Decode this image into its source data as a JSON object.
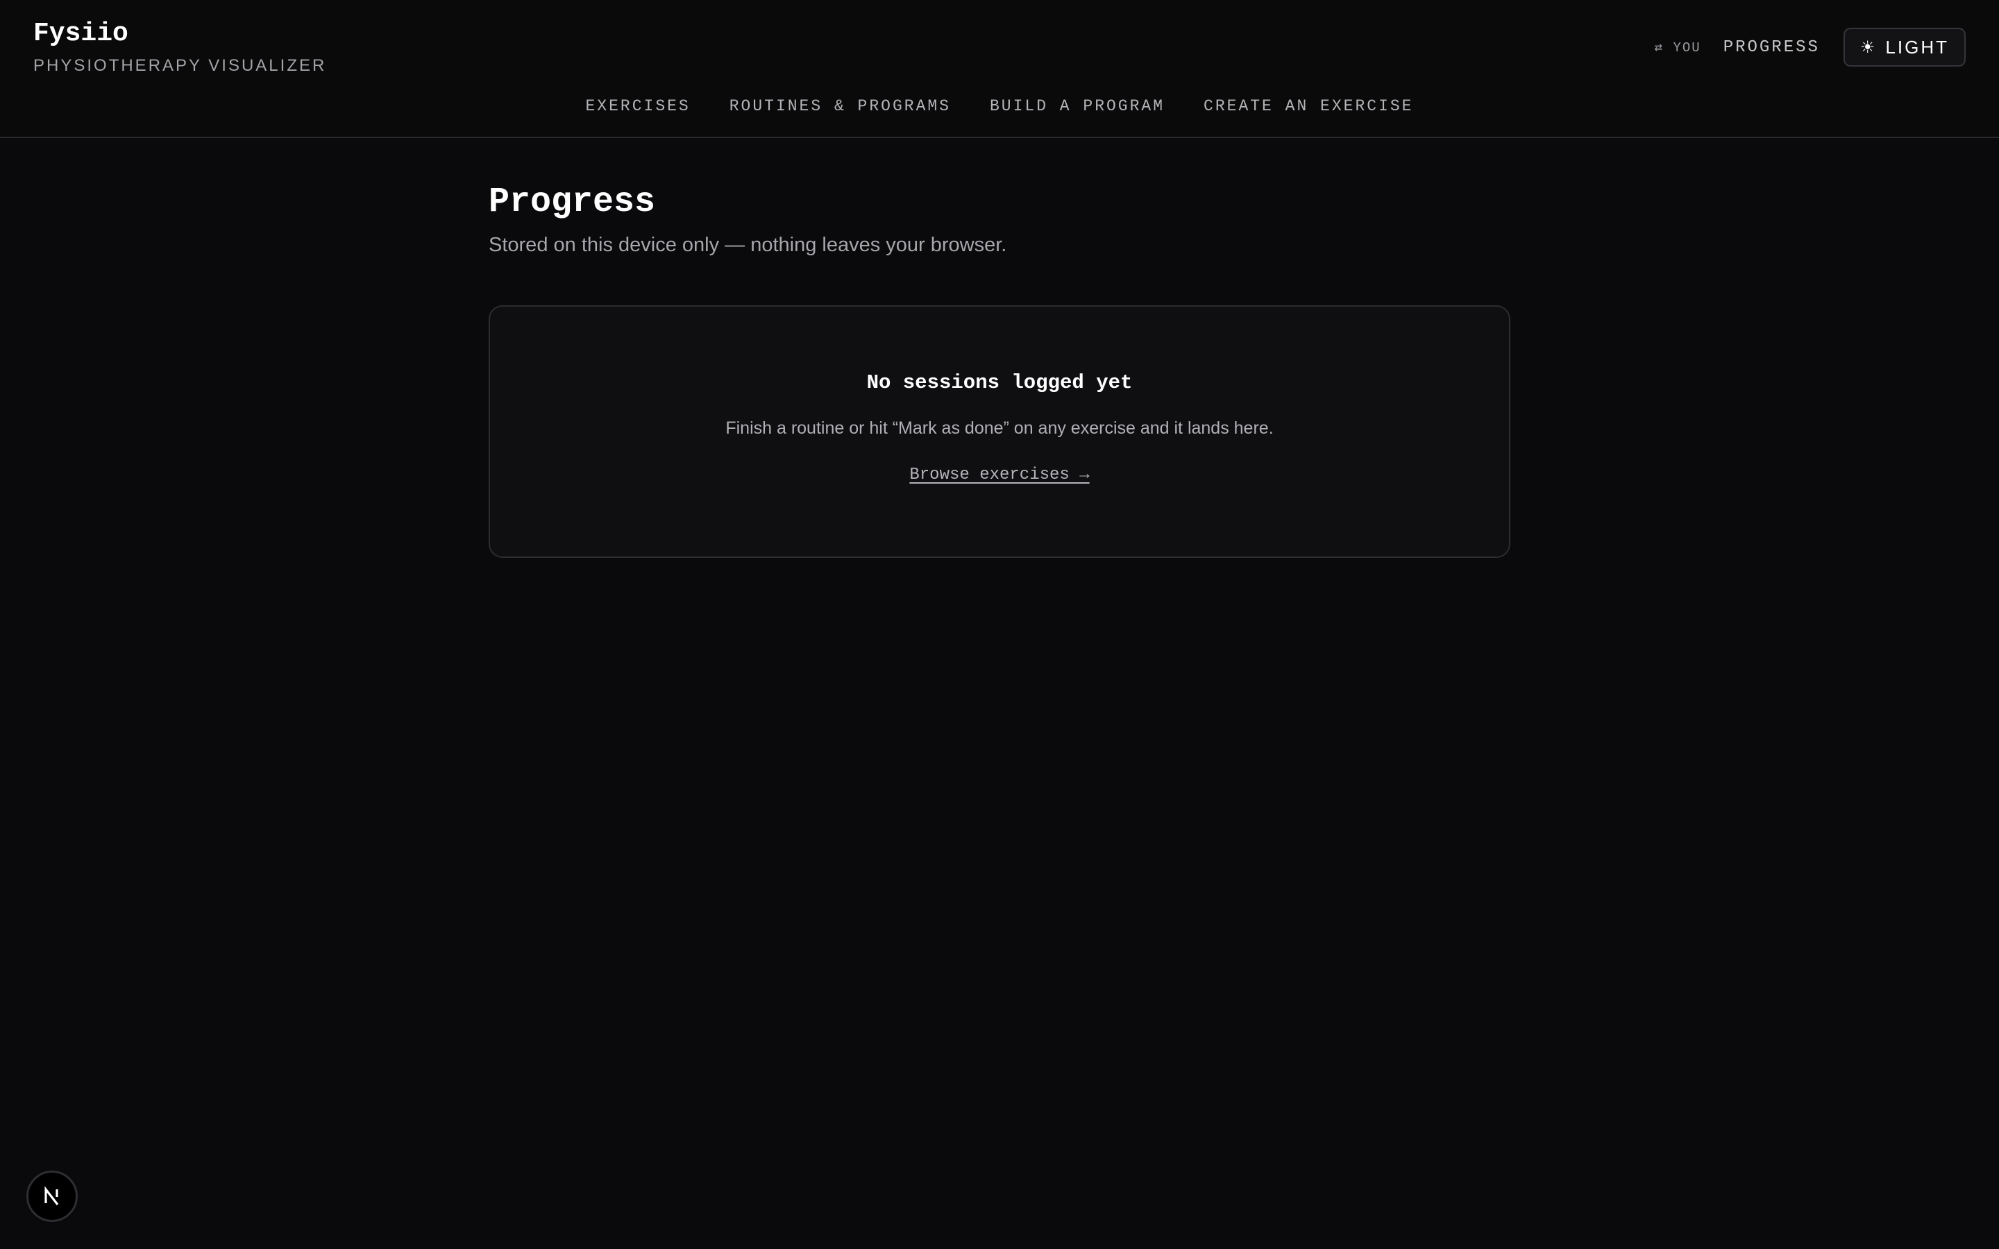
{
  "app": {
    "title": "Fysiio",
    "subtitle": "PHYSIOTHERAPY VISUALIZER"
  },
  "header": {
    "you_label": "⇄ YOU",
    "progress_label": "PROGRESS",
    "theme_icon": "☀",
    "theme_label": "LIGHT"
  },
  "nav": {
    "items": [
      {
        "label": "EXERCISES"
      },
      {
        "label": "ROUTINES & PROGRAMS"
      },
      {
        "label": "BUILD A PROGRAM"
      },
      {
        "label": "CREATE AN EXERCISE"
      }
    ]
  },
  "main": {
    "title": "Progress",
    "subtitle": "Stored on this device only — nothing leaves your browser."
  },
  "empty_state": {
    "title": "No sessions logged yet",
    "text": "Finish a routine or hit “Mark as done” on any exercise and it lands here.",
    "link_label": "Browse exercises →"
  },
  "dev_badge": {
    "icon": "nextjs-logo-icon"
  }
}
